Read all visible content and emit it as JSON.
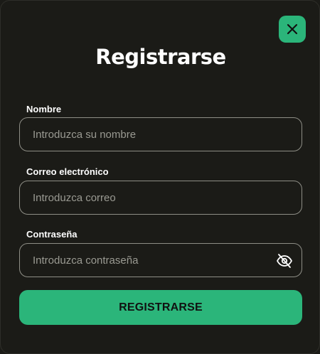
{
  "modal": {
    "title": "Registrarse",
    "close_icon": "close-icon"
  },
  "form": {
    "name": {
      "label": "Nombre",
      "placeholder": "Introduzca su nombre",
      "value": ""
    },
    "email": {
      "label": "Correo electrónico",
      "placeholder": "Introduzca correo",
      "value": ""
    },
    "password": {
      "label": "Contraseña",
      "placeholder": "Introduzca contraseña",
      "value": "",
      "toggle_icon": "eye-off-icon"
    },
    "submit_label": "REGISTRARSE"
  },
  "colors": {
    "background": "#1b1b17",
    "accent": "#2bb57a",
    "border": "#8e8e86",
    "text": "#ffffff",
    "placeholder": "#9a9a92"
  }
}
